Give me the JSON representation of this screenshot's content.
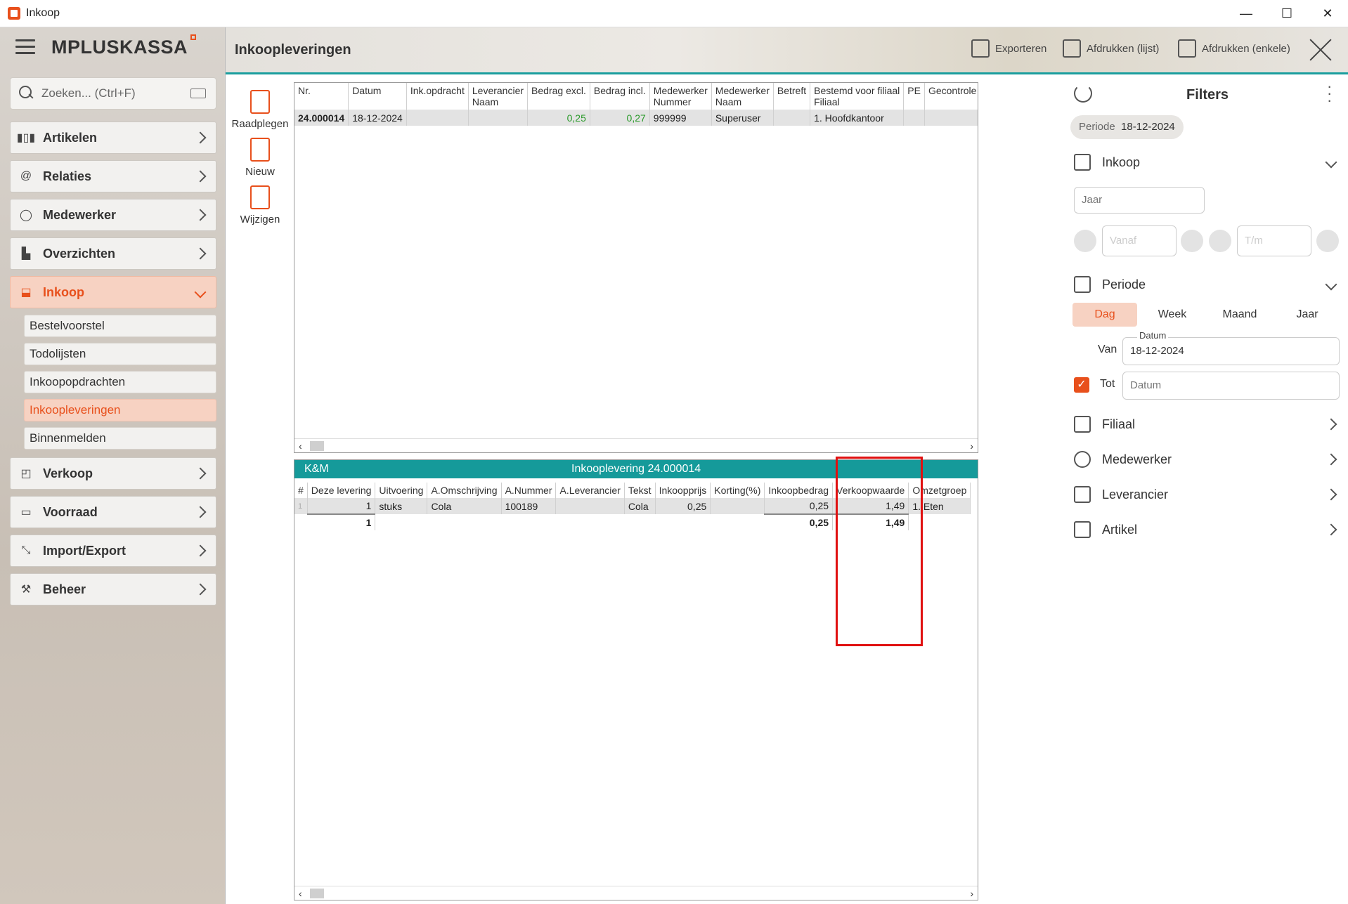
{
  "window": {
    "title": "Inkoop",
    "minimize": "—",
    "maximize": "☐",
    "close": "✕"
  },
  "logo": {
    "text": "MPLUSKASSA"
  },
  "search": {
    "placeholder": "Zoeken... (Ctrl+F)"
  },
  "nav": [
    {
      "label": "Artikelen",
      "icon": "barcode-icon"
    },
    {
      "label": "Relaties",
      "icon": "contact-icon"
    },
    {
      "label": "Medewerker",
      "icon": "user-icon"
    },
    {
      "label": "Overzichten",
      "icon": "chart-icon"
    },
    {
      "label": "Inkoop",
      "icon": "inbox-icon"
    },
    {
      "label": "Verkoop",
      "icon": "shopping-bag-icon"
    },
    {
      "label": "Voorraad",
      "icon": "archive-icon"
    },
    {
      "label": "Import/Export",
      "icon": "import-export-icon"
    },
    {
      "label": "Beheer",
      "icon": "tools-icon"
    }
  ],
  "subnav": [
    "Bestelvoorstel",
    "Todolijsten",
    "Inkoopopdrachten",
    "Inkoopleveringen",
    "Binnenmelden"
  ],
  "header": {
    "title": "Inkoopleveringen",
    "export": "Exporteren",
    "print_list": "Afdrukken (lijst)",
    "print_single": "Afdrukken (enkele)"
  },
  "actions": {
    "view": "Raadplegen",
    "new": "Nieuw",
    "edit": "Wijzigen"
  },
  "top_table": {
    "headers": [
      [
        "Nr.",
        ""
      ],
      [
        "Datum",
        ""
      ],
      [
        "Ink.opdracht",
        ""
      ],
      [
        "Leverancier",
        "Naam"
      ],
      [
        "Bedrag excl.",
        ""
      ],
      [
        "Bedrag incl.",
        ""
      ],
      [
        "Medewerker",
        "Nummer"
      ],
      [
        "Medewerker",
        "Naam"
      ],
      [
        "Betreft",
        ""
      ],
      [
        "Bestemd voor filiaal",
        "Filiaal"
      ],
      [
        "PE",
        ""
      ],
      [
        "Gecontrole",
        ""
      ]
    ],
    "row": [
      "24.000014",
      "18-12-2024",
      "",
      "",
      "0,25",
      "0,27",
      "999999",
      "Superuser",
      "",
      "1. Hoofdkantoor",
      "",
      ""
    ]
  },
  "detail": {
    "left_label": "K&M",
    "title": "Inkooplevering 24.000014",
    "headers": [
      "#",
      "Deze levering",
      "Uitvoering",
      "A.Omschrijving",
      "A.Nummer",
      "A.Leverancier",
      "Tekst",
      "Inkoopprijs",
      "Korting(%)",
      "Inkoopbedrag",
      "Verkoopwaarde",
      "Omzetgroep"
    ],
    "row": [
      "1",
      "1",
      "stuks",
      "Cola",
      "100189",
      "",
      "Cola",
      "0,25",
      "",
      "0,25",
      "1,49",
      "1. Eten"
    ],
    "totals": {
      "qty": "1",
      "purchase": "0,25",
      "sales": "1,49"
    }
  },
  "filters": {
    "title": "Filters",
    "pill_label": "Periode",
    "pill_value": "18-12-2024",
    "inkoop": "Inkoop",
    "year_placeholder": "Jaar",
    "from_placeholder": "Vanaf",
    "to_placeholder": "T/m",
    "periode": "Periode",
    "segments": [
      "Dag",
      "Week",
      "Maand",
      "Jaar"
    ],
    "van_label": "Van",
    "datum_label": "Datum",
    "van_value": "18-12-2024",
    "tot_label": "Tot",
    "tot_placeholder": "Datum",
    "filiaal": "Filiaal",
    "medewerker": "Medewerker",
    "leverancier": "Leverancier",
    "artikel": "Artikel"
  },
  "colors": {
    "accent": "#e8501c",
    "teal": "#159a9a",
    "highlight": "#e01010"
  }
}
